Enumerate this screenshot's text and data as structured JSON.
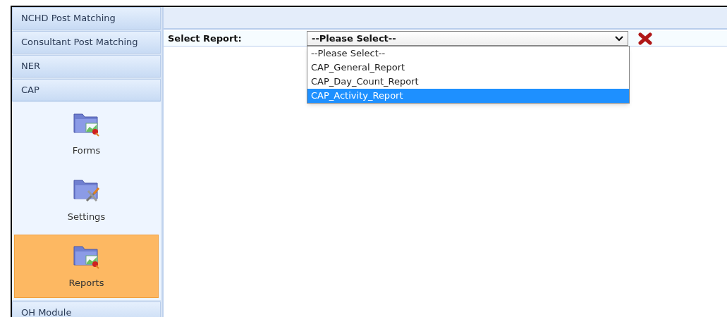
{
  "sidebar": {
    "sections": [
      {
        "label": "NCHD Post Matching",
        "expanded": false
      },
      {
        "label": "Consultant Post Matching",
        "expanded": false
      },
      {
        "label": "NER",
        "expanded": false
      },
      {
        "label": "CAP",
        "expanded": true,
        "items": [
          {
            "label": "Forms",
            "kind": "chart",
            "selected": false
          },
          {
            "label": "Settings",
            "kind": "tools",
            "selected": false
          },
          {
            "label": "Reports",
            "kind": "chart",
            "selected": true
          }
        ]
      },
      {
        "label": "OH Module",
        "expanded": false
      }
    ]
  },
  "report_form": {
    "label": "Select Report:",
    "select": {
      "value": "--Please Select--",
      "options": [
        {
          "label": "--Please Select--",
          "highlighted": false
        },
        {
          "label": "CAP_General_Report",
          "highlighted": false
        },
        {
          "label": "CAP_Day_Count_Report",
          "highlighted": false
        },
        {
          "label": "CAP_Activity_Report",
          "highlighted": true
        }
      ]
    }
  }
}
